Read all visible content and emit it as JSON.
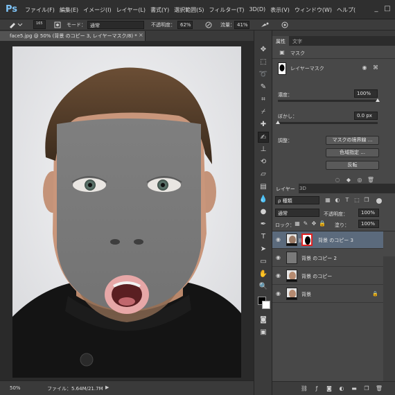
{
  "app": {
    "logo": "Ps"
  },
  "menu": [
    "ファイル(F)",
    "編集(E)",
    "イメージ(I)",
    "レイヤー(L)",
    "書式(Y)",
    "選択範囲(S)",
    "フィルター(T)",
    "3D(D)",
    "表示(V)",
    "ウィンドウ(W)",
    "ヘルプ("
  ],
  "window_controls": {
    "minimize": "_",
    "maximize": "□"
  },
  "options": {
    "brush_size": "165",
    "mode_label": "モード：",
    "mode_value": "通常",
    "opacity_label": "不透明度：",
    "opacity_value": "62%",
    "flow_label": "流量：",
    "flow_value": "41%"
  },
  "document": {
    "tab_title": "face5.jpg @ 50% (背景 のコピー 3, レイヤーマスク/8) *",
    "close": "×",
    "zoom": "50%",
    "file_info": "ファイル：5.64M/21.7M",
    "status_arrow": "▶"
  },
  "properties": {
    "tabs": [
      "属性",
      "文字"
    ],
    "section": "マスク",
    "mask_type": "レイヤーマスク",
    "density_label": "濃度：",
    "density_value": "100%",
    "density": 1.0,
    "feather_label": "ぼかし：",
    "feather_value": "0.0 px",
    "feather": 0.0,
    "adjust_label": "調整：",
    "buttons": [
      "マスクの境界線 ...",
      "色域指定 ...",
      "反転"
    ]
  },
  "layers": {
    "tabs": [
      "レイヤー",
      "3D"
    ],
    "filter_label": "ρ 種類",
    "blend_mode": "通常",
    "opacity_label": "不透明度：",
    "opacity_value": "100%",
    "lock_label": "ロック：",
    "fill_label": "塗り：",
    "fill_value": "100%",
    "items": [
      {
        "name": "背景 のコピー 3",
        "selected": true
      },
      {
        "name": "背景 のコピー 2",
        "selected": false
      },
      {
        "name": "背景 のコピー",
        "selected": false
      },
      {
        "name": "背景",
        "selected": false
      }
    ]
  },
  "colors": {
    "accent_selected_layer": "#5b6a7c",
    "mask_highlight": "#e02020",
    "app_bg": "#3a3a3a"
  }
}
